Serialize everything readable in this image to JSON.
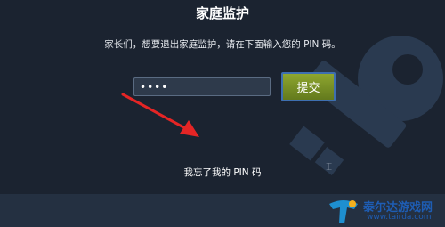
{
  "dialog": {
    "title": "家庭监护",
    "prompt": "家长们，想要退出家庭监护，请在下面输入您的 PIN 码。",
    "pin_value": "••••",
    "submit_label": "提交",
    "forgot_label": "我忘了我的 PIN 码"
  },
  "overlay": {
    "arrow_color": "#e52525"
  },
  "watermark": {
    "name": "泰尔达游戏网",
    "url": "www.tairda.com"
  },
  "icons": {
    "background": "key-icon",
    "logo": "tairda-logo-icon"
  },
  "colors": {
    "background": "#1b2330",
    "submit": "#7b9327",
    "submit_border": "#3e6fb0",
    "brand": "#1e5db4"
  }
}
